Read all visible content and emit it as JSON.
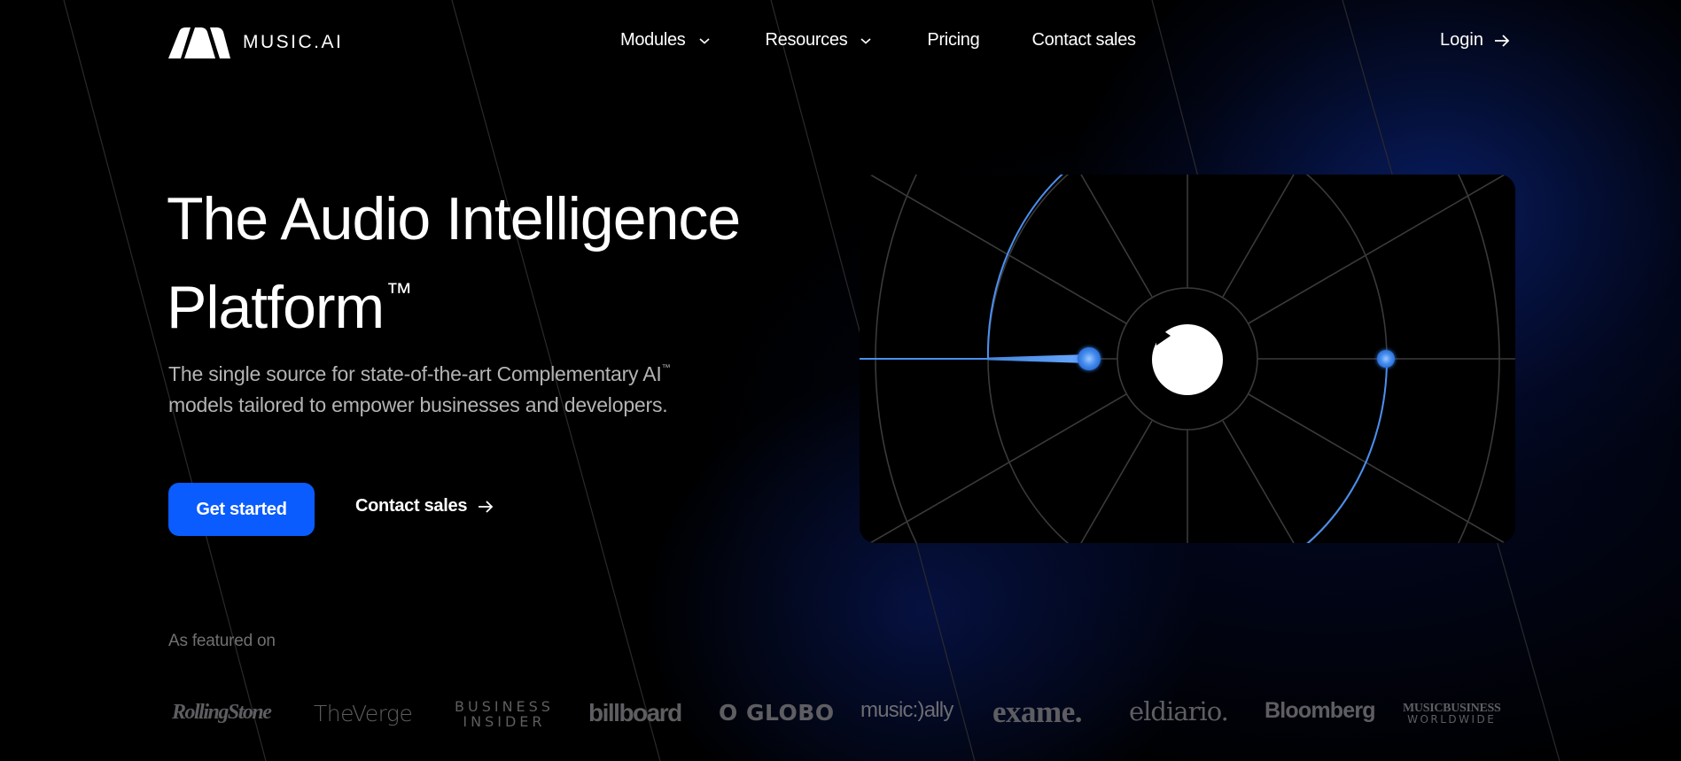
{
  "brand": {
    "name": "MUSIC.AI",
    "logo_icon": "music-ai-logo-mark",
    "accent_color": "#0a5cff",
    "waveform_color": "#4a90f0"
  },
  "nav": {
    "items": [
      {
        "label": "Modules",
        "has_dropdown": true
      },
      {
        "label": "Resources",
        "has_dropdown": true
      },
      {
        "label": "Pricing",
        "has_dropdown": false
      },
      {
        "label": "Contact sales",
        "has_dropdown": false
      }
    ],
    "login_label": "Login"
  },
  "hero": {
    "title_line1": "The Audio Intelligence",
    "title_line2": "Platform",
    "title_mark": "™",
    "subtitle_part1": "The single source for state-of-the-art Complementary AI",
    "subtitle_mark": "™",
    "subtitle_part2": " models tailored to empower businesses and developers.",
    "primary_cta": "Get started",
    "secondary_cta": "Contact sales"
  },
  "video": {
    "play_icon": "play-icon",
    "state": "paused"
  },
  "featured": {
    "label": "As featured on",
    "logos": [
      {
        "name": "Rolling Stone",
        "text": "RollingStone"
      },
      {
        "name": "The Verge",
        "text": "TheVerge"
      },
      {
        "name": "Business Insider",
        "line1": "BUSINESS",
        "line2": "INSIDER"
      },
      {
        "name": "Billboard",
        "text": "billboard"
      },
      {
        "name": "O Globo",
        "text": "O GLOBO"
      },
      {
        "name": "Music Ally",
        "text": "music:)ally"
      },
      {
        "name": "Exame",
        "text": "exame."
      },
      {
        "name": "elDiario",
        "text": "eldiario."
      },
      {
        "name": "Bloomberg",
        "text": "Bloomberg"
      },
      {
        "name": "Music Business Worldwide",
        "line1": "MUSICBUSINESS",
        "line2": "WORLDWIDE"
      }
    ]
  }
}
